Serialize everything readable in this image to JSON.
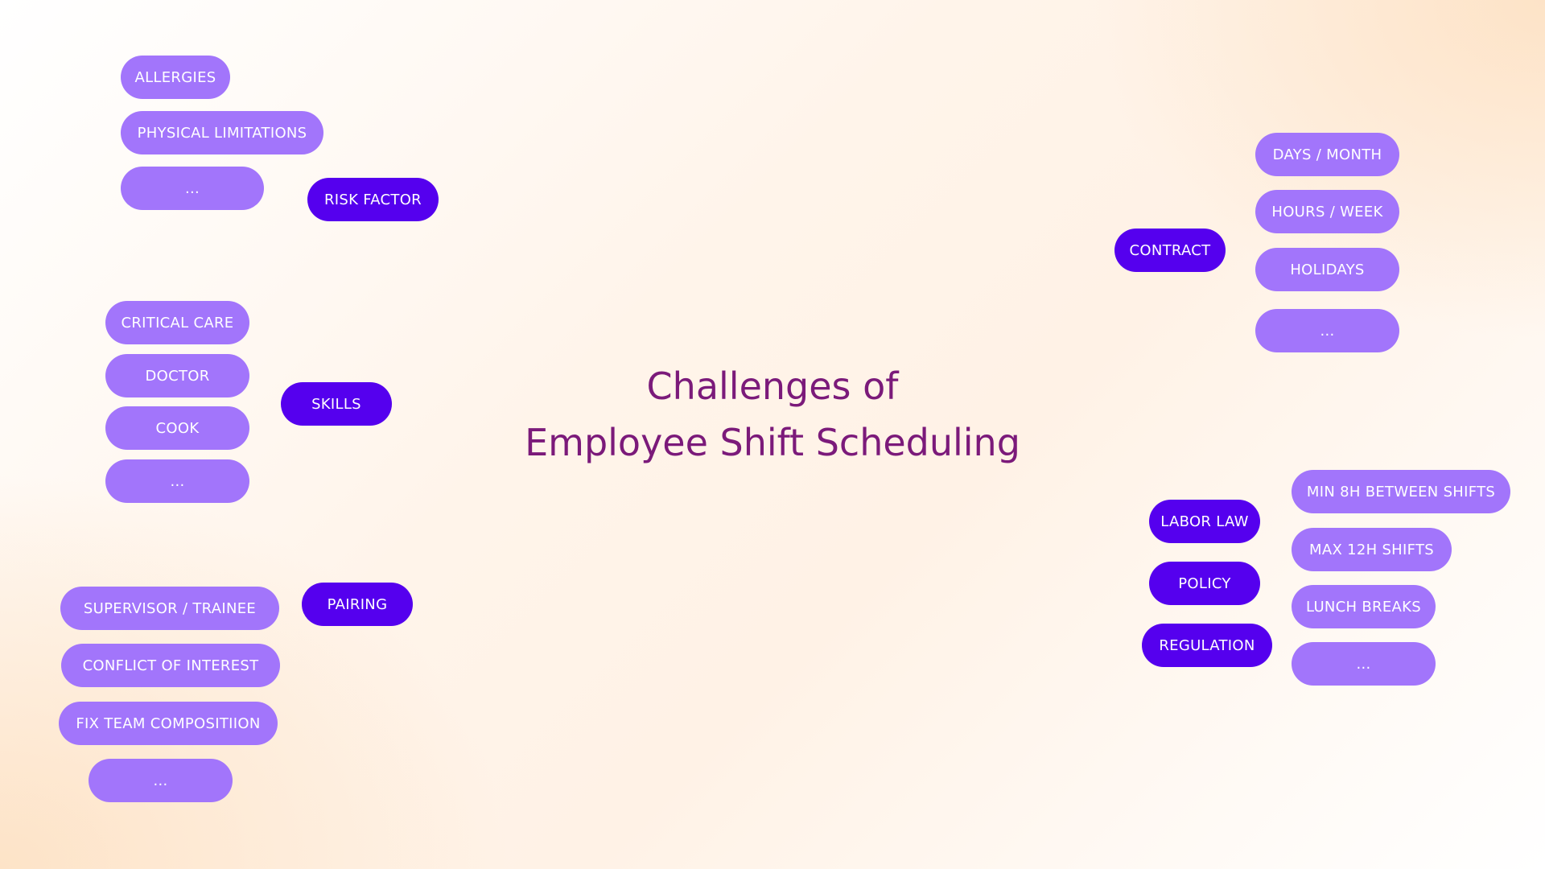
{
  "title": {
    "line1": "Challenges of",
    "line2": "Employee Shift Scheduling"
  },
  "colors": {
    "title": "#7b1a7a",
    "category": "#5500ee",
    "leaf": "#a275fb"
  },
  "risk_factor": {
    "label": "RISK FACTOR",
    "items": [
      "ALLERGIES",
      "PHYSICAL LIMITATIONS",
      "..."
    ]
  },
  "skills": {
    "label": "SKILLS",
    "items": [
      "CRITICAL CARE",
      "DOCTOR",
      "COOK",
      "..."
    ]
  },
  "pairing": {
    "label": "PAIRING",
    "items": [
      "SUPERVISOR / TRAINEE",
      "CONFLICT OF INTEREST",
      "FIX TEAM COMPOSITIION",
      "..."
    ]
  },
  "contract": {
    "label": "CONTRACT",
    "items": [
      "DAYS / MONTH",
      "HOURS / WEEK",
      "HOLIDAYS",
      "..."
    ]
  },
  "regulations": {
    "labels": [
      "LABOR LAW",
      "POLICY",
      "REGULATION"
    ],
    "items": [
      "MIN 8H BETWEEN SHIFTS",
      "MAX 12H SHIFTS",
      "LUNCH BREAKS",
      "..."
    ]
  }
}
